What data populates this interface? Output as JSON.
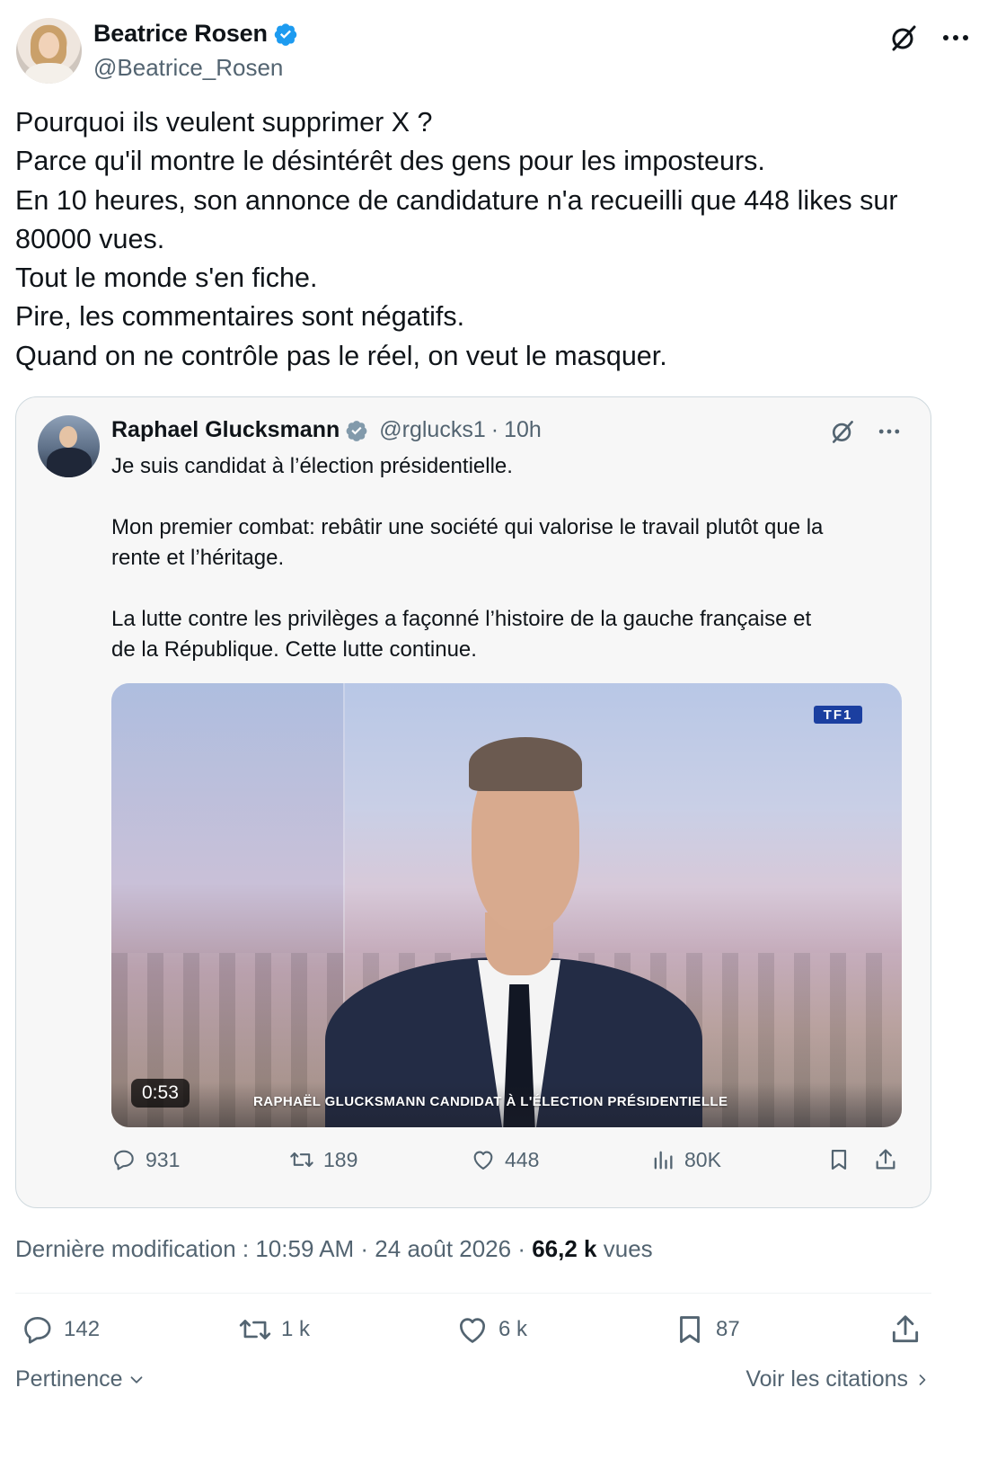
{
  "author": {
    "display_name": "Beatrice Rosen",
    "handle": "@Beatrice_Rosen",
    "verified_icon": "verified-badge-icon"
  },
  "top_actions": {
    "grok_icon": "grok-icon",
    "more_icon": "more-icon"
  },
  "tweet": {
    "lines": [
      "Pourquoi ils veulent supprimer X ?",
      "Parce qu'il montre le désintérêt des gens pour les imposteurs.",
      "En 10 heures, son annonce de candidature n'a recueilli que 448 likes sur",
      "80000 vues.",
      "Tout le monde s'en fiche.",
      "Pire, les commentaires sont négatifs.",
      "Quand on ne contrôle pas le réel, on veut le masquer."
    ]
  },
  "quoted": {
    "display_name": "Raphael Glucksmann",
    "handle": "@rglucks1",
    "separator": "·",
    "time": "10h",
    "paragraphs": [
      [
        "Je suis candidat à l’élection présidentielle."
      ],
      [
        "Mon premier combat: rebâtir une société qui valorise le travail plutôt que la",
        "rente et l’héritage."
      ],
      [
        "La lutte contre les privilèges a façonné l’histoire de la gauche française et",
        "de la République. Cette lutte continue."
      ]
    ],
    "video": {
      "duration": "0:53",
      "channel_logo": "TF1",
      "caption": "RAPHAËL GLUCKSMANN CANDIDAT À L'ÉLECTION PRÉSIDENTIELLE"
    },
    "metrics": {
      "replies": "931",
      "reposts": "189",
      "likes": "448",
      "views": "80K"
    }
  },
  "meta": {
    "prefix": "Dernière modification : 10:59 AM · 24 août 2026 · ",
    "views_count": "66,2 k",
    "views_label": " vues"
  },
  "actions": {
    "replies": "142",
    "reposts": "1 k",
    "likes": "6 k",
    "bookmarks": "87"
  },
  "footer": {
    "sort_label": "Pertinence",
    "quotes_label": "Voir les citations"
  },
  "colors": {
    "text": "#0f1419",
    "secondary": "#536471",
    "verified": "#1d9bf0",
    "border": "#cfd9de"
  }
}
